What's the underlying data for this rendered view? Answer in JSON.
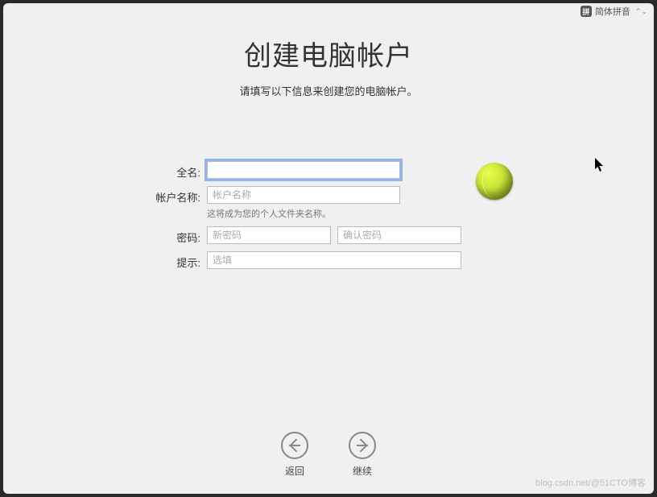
{
  "status": {
    "ime_badge": "拼",
    "ime_label": "简体拼音"
  },
  "header": {
    "title": "创建电脑帐户",
    "subtitle": "请填写以下信息来创建您的电脑帐户。"
  },
  "form": {
    "full_name": {
      "label": "全名:",
      "value": ""
    },
    "account_name": {
      "label": "帐户名称:",
      "placeholder": "帐户名称",
      "hint": "这将成为您的个人文件夹名称。"
    },
    "password": {
      "label": "密码:",
      "new_placeholder": "新密码",
      "confirm_placeholder": "确认密码"
    },
    "hint": {
      "label": "提示:",
      "placeholder": "选填"
    }
  },
  "footer": {
    "back": "返回",
    "continue": "继续"
  },
  "watermark": "blog.csdn.net/@51CTO博客"
}
